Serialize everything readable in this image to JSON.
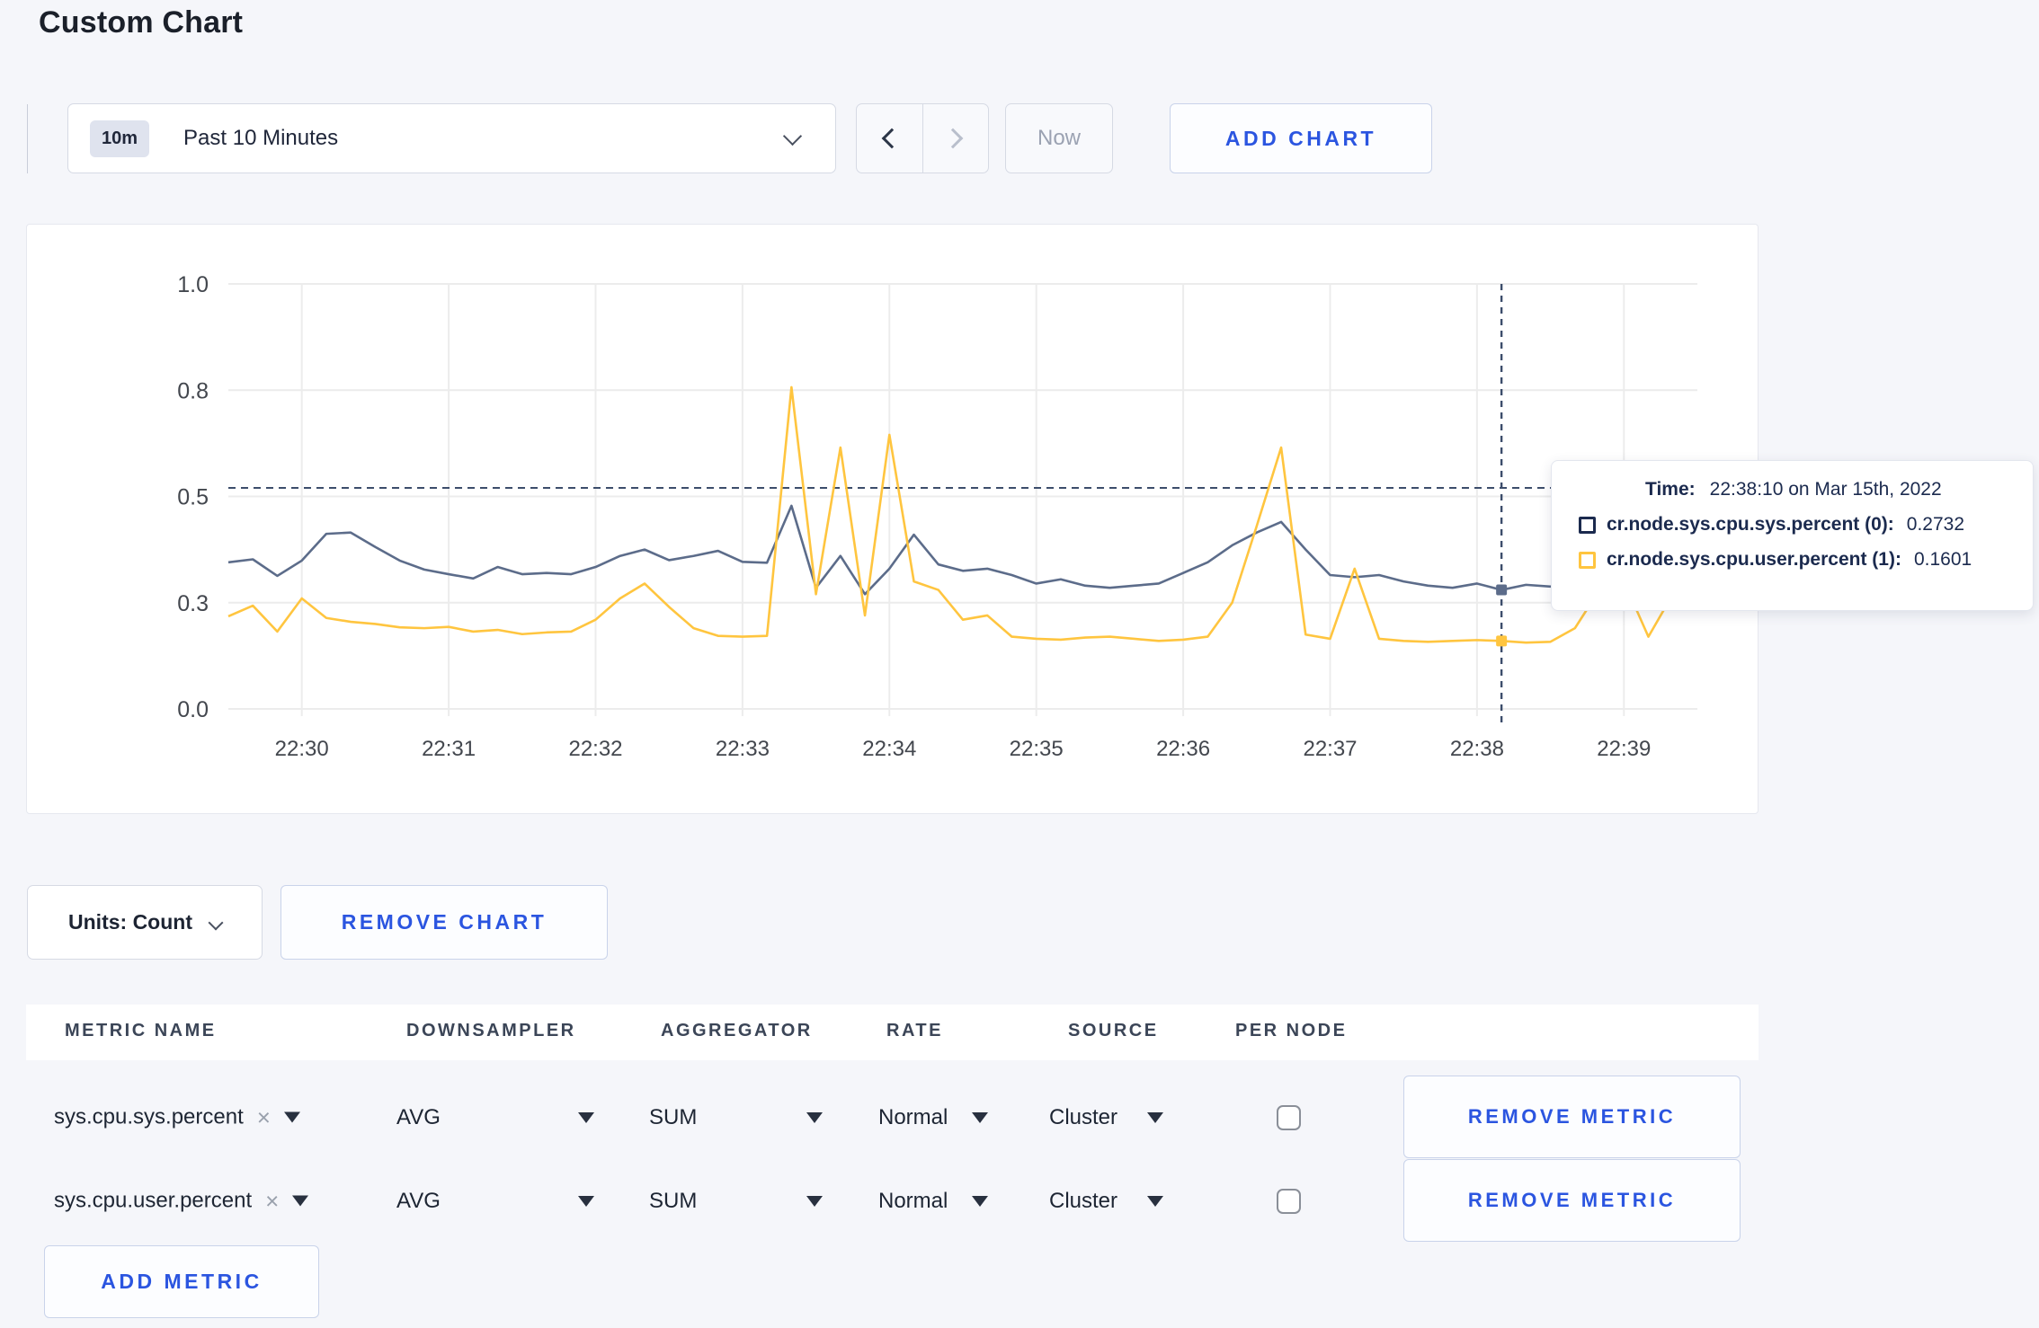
{
  "title": "Custom Chart",
  "toolbar": {
    "range_badge": "10m",
    "range_label": "Past 10 Minutes",
    "now_label": "Now",
    "add_chart_label": "ADD CHART"
  },
  "chart_data": {
    "type": "line",
    "title": "",
    "xlabel": "",
    "ylabel": "",
    "x_ticks": [
      "22:30",
      "22:31",
      "22:32",
      "22:33",
      "22:34",
      "22:35",
      "22:36",
      "22:37",
      "22:38",
      "22:39"
    ],
    "y_tick_labels": [
      "0.0",
      "0.3",
      "0.5",
      "0.8",
      "1.0"
    ],
    "y_tick_values": [
      0,
      0.25,
      0.5,
      0.75,
      1.0
    ],
    "ylim": [
      0,
      1
    ],
    "grid": true,
    "legend_position": "none",
    "start_time": "22:29:30",
    "domain_seconds": 600,
    "step_seconds": 10,
    "guideline_value": 0.52,
    "hover": {
      "index": 52,
      "time": "22:38:10"
    },
    "colors": {
      "grid": "#ececec",
      "axis_text": "#43474e",
      "crosshair": "#3c4d6b"
    },
    "series": [
      {
        "name": "cr.node.sys.cpu.sys.percent",
        "color": "#5c6c8a",
        "values": [
          0.345,
          0.352,
          0.313,
          0.349,
          0.412,
          0.415,
          0.381,
          0.349,
          0.328,
          0.317,
          0.307,
          0.334,
          0.317,
          0.32,
          0.317,
          0.334,
          0.36,
          0.375,
          0.35,
          0.36,
          0.372,
          0.346,
          0.344,
          0.478,
          0.285,
          0.36,
          0.27,
          0.33,
          0.41,
          0.34,
          0.325,
          0.33,
          0.315,
          0.295,
          0.305,
          0.29,
          0.285,
          0.29,
          0.295,
          0.32,
          0.345,
          0.385,
          0.415,
          0.44,
          0.375,
          0.315,
          0.31,
          0.315,
          0.3,
          0.29,
          0.285,
          0.295,
          0.28,
          0.292,
          0.288,
          0.3,
          0.318,
          0.298,
          0.305,
          0.31
        ]
      },
      {
        "name": "cr.node.sys.cpu.user.percent",
        "color": "#ffc53f",
        "values": [
          0.218,
          0.243,
          0.182,
          0.26,
          0.214,
          0.205,
          0.2,
          0.192,
          0.19,
          0.193,
          0.182,
          0.186,
          0.176,
          0.18,
          0.182,
          0.21,
          0.26,
          0.295,
          0.24,
          0.19,
          0.172,
          0.17,
          0.172,
          0.757,
          0.27,
          0.615,
          0.22,
          0.645,
          0.3,
          0.28,
          0.21,
          0.22,
          0.17,
          0.165,
          0.163,
          0.168,
          0.17,
          0.165,
          0.16,
          0.163,
          0.17,
          0.25,
          0.43,
          0.615,
          0.175,
          0.165,
          0.33,
          0.165,
          0.16,
          0.158,
          0.16,
          0.162,
          0.16,
          0.156,
          0.158,
          0.19,
          0.28,
          0.3,
          0.17,
          0.27
        ]
      }
    ]
  },
  "tooltip": {
    "time_label": "Time:",
    "time_value": "22:38:10 on Mar 15th, 2022",
    "rows": [
      {
        "label": "cr.node.sys.cpu.sys.percent (0):",
        "value": "0.2732",
        "color": "#1b2a4e"
      },
      {
        "label": "cr.node.sys.cpu.user.percent (1):",
        "value": "0.1601",
        "color": "#ffc53f"
      }
    ]
  },
  "units": {
    "label": "Units: Count",
    "remove_chart_label": "REMOVE CHART"
  },
  "metrics": {
    "columns": [
      "METRIC NAME",
      "DOWNSAMPLER",
      "AGGREGATOR",
      "RATE",
      "SOURCE",
      "PER NODE"
    ],
    "remove_icon": "×",
    "rows": [
      {
        "name": "sys.cpu.sys.percent",
        "downsampler": "AVG",
        "aggregator": "SUM",
        "rate": "Normal",
        "source": "Cluster",
        "per_node_checked": false,
        "remove_label": "REMOVE METRIC"
      },
      {
        "name": "sys.cpu.user.percent",
        "downsampler": "AVG",
        "aggregator": "SUM",
        "rate": "Normal",
        "source": "Cluster",
        "per_node_checked": false,
        "remove_label": "REMOVE METRIC"
      }
    ],
    "add_metric_label": "ADD METRIC"
  }
}
